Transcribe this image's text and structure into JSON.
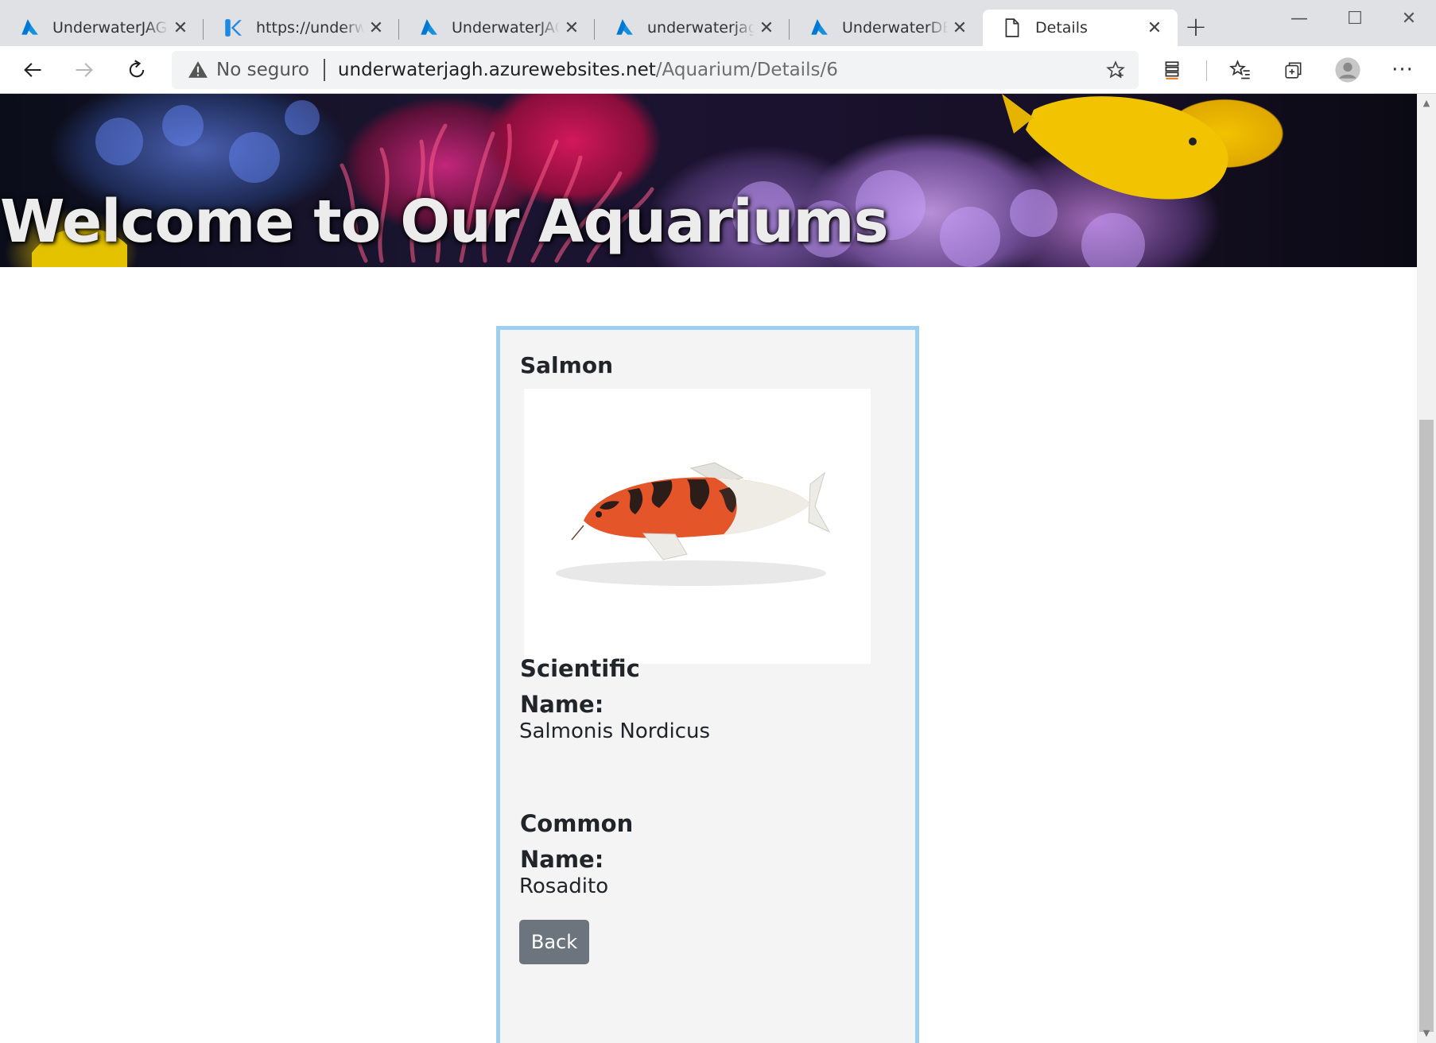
{
  "browser": {
    "tabs": [
      {
        "title": "UnderwaterJAGH - ",
        "icon": "azure-icon",
        "active": false
      },
      {
        "title": "https://underwater",
        "icon": "kudu-icon",
        "active": false
      },
      {
        "title": "UnderwaterJAGH - ",
        "icon": "azure-icon",
        "active": false
      },
      {
        "title": "underwaterjagh - ",
        "icon": "azure-icon",
        "active": false
      },
      {
        "title": "UnderwaterDB (ur",
        "icon": "azure-icon",
        "active": false
      },
      {
        "title": "Details",
        "icon": "page-icon",
        "active": true
      }
    ],
    "address": {
      "security_label": "No seguro",
      "host": "underwaterjagh.azurewebsites.net",
      "path": "/Aquarium/Details/6"
    },
    "colors": {
      "azure_blue": "#0078d4",
      "active_tab": "#ffffff",
      "tab_strip": "#dfe1e5"
    }
  },
  "page": {
    "banner_title": "Welcome to Our Aquariums",
    "card": {
      "title": "Salmon",
      "scientific_label": "Scientific Name:",
      "scientific_value": "Salmonis Nordicus",
      "common_label": "Common Name:",
      "common_value": "Rosadito",
      "back_label": "Back",
      "border_color": "#9ccff0"
    }
  }
}
